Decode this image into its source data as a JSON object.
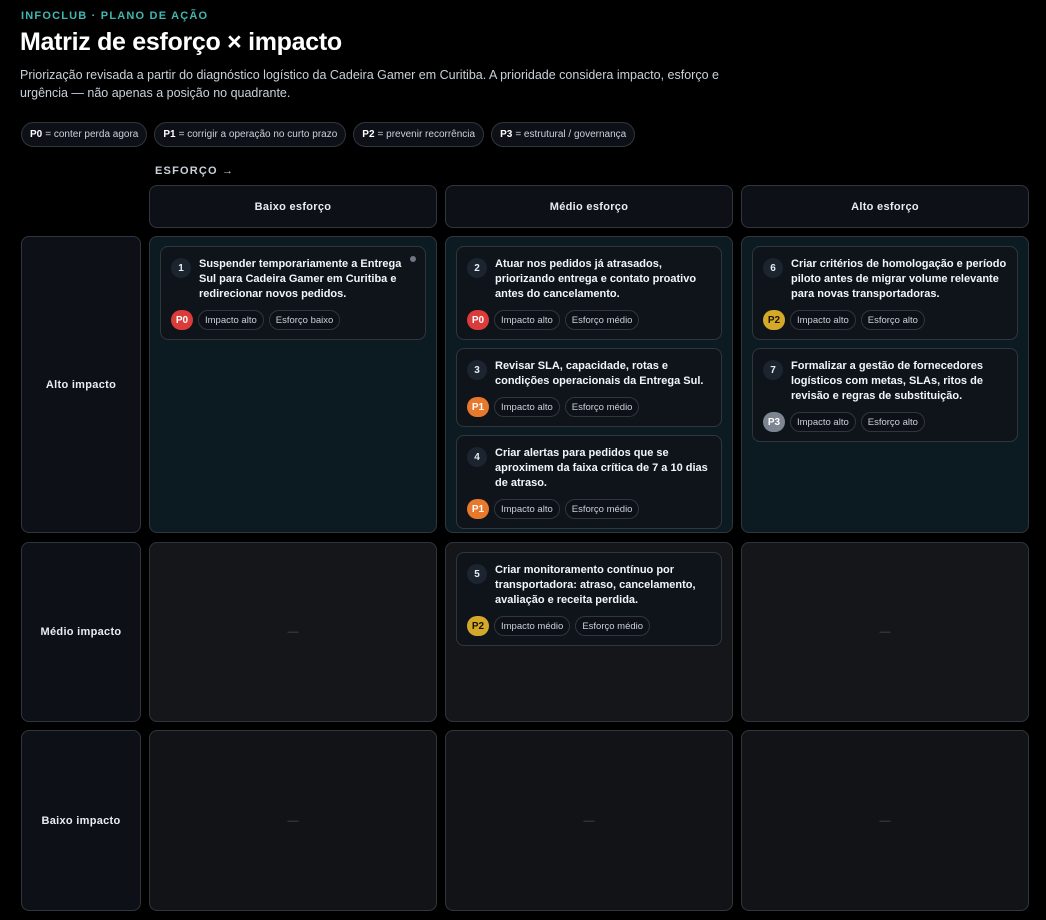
{
  "header": {
    "eyebrow": "INFOCLUB · PLANO DE AÇÃO",
    "title": "Matriz de esforço × impacto",
    "subtitle": "Priorização revisada a partir do diagnóstico logístico da Cadeira Gamer em Curitiba. A prioridade considera impacto, esforço e urgência — não apenas a posição no quadrante."
  },
  "legend": [
    {
      "code": "P0",
      "text": "= conter perda agora"
    },
    {
      "code": "P1",
      "text": "= corrigir a operação no curto prazo"
    },
    {
      "code": "P2",
      "text": "= prevenir recorrência"
    },
    {
      "code": "P3",
      "text": "= estrutural / governança"
    }
  ],
  "axis_label": "ESFORÇO →",
  "columns": [
    "Baixo esforço",
    "Médio esforço",
    "Alto esforço"
  ],
  "rows": [
    "Alto impacto",
    "Médio impacto",
    "Baixo impacto"
  ],
  "empty_marker": "—",
  "priority_colors": {
    "P0": "#da3b3b",
    "P1": "#e8782b",
    "P2": "#d4a92a",
    "P3": "#7d8590"
  },
  "cards": [
    {
      "num": "1",
      "text": "Suspender temporariamente a Entrega Sul para Cadeira Gamer em Curitiba e redirecionar novos pedidos.",
      "prio": "P0",
      "impact": "Impacto alto",
      "effort": "Esforço baixo"
    },
    {
      "num": "2",
      "text": "Atuar nos pedidos já atrasados, priorizando entrega e contato proativo antes do cancelamento.",
      "prio": "P0",
      "impact": "Impacto alto",
      "effort": "Esforço médio"
    },
    {
      "num": "3",
      "text": "Revisar SLA, capacidade, rotas e condições operacionais da Entrega Sul.",
      "prio": "P1",
      "impact": "Impacto alto",
      "effort": "Esforço médio"
    },
    {
      "num": "4",
      "text": "Criar alertas para pedidos que se aproximem da faixa crítica de 7 a 10 dias de atraso.",
      "prio": "P1",
      "impact": "Impacto alto",
      "effort": "Esforço médio"
    },
    {
      "num": "5",
      "text": "Criar monitoramento contínuo por transportadora: atraso, cancelamento, avaliação e receita perdida.",
      "prio": "P2",
      "impact": "Impacto médio",
      "effort": "Esforço médio"
    },
    {
      "num": "6",
      "text": "Criar critérios de homologação e período piloto antes de migrar volume relevante para novas transportadoras.",
      "prio": "P2",
      "impact": "Impacto alto",
      "effort": "Esforço alto"
    },
    {
      "num": "7",
      "text": "Formalizar a gestão de fornecedores logísticos com metas, SLAs, ritos de revisão e regras de substituição.",
      "prio": "P3",
      "impact": "Impacto alto",
      "effort": "Esforço alto"
    }
  ]
}
